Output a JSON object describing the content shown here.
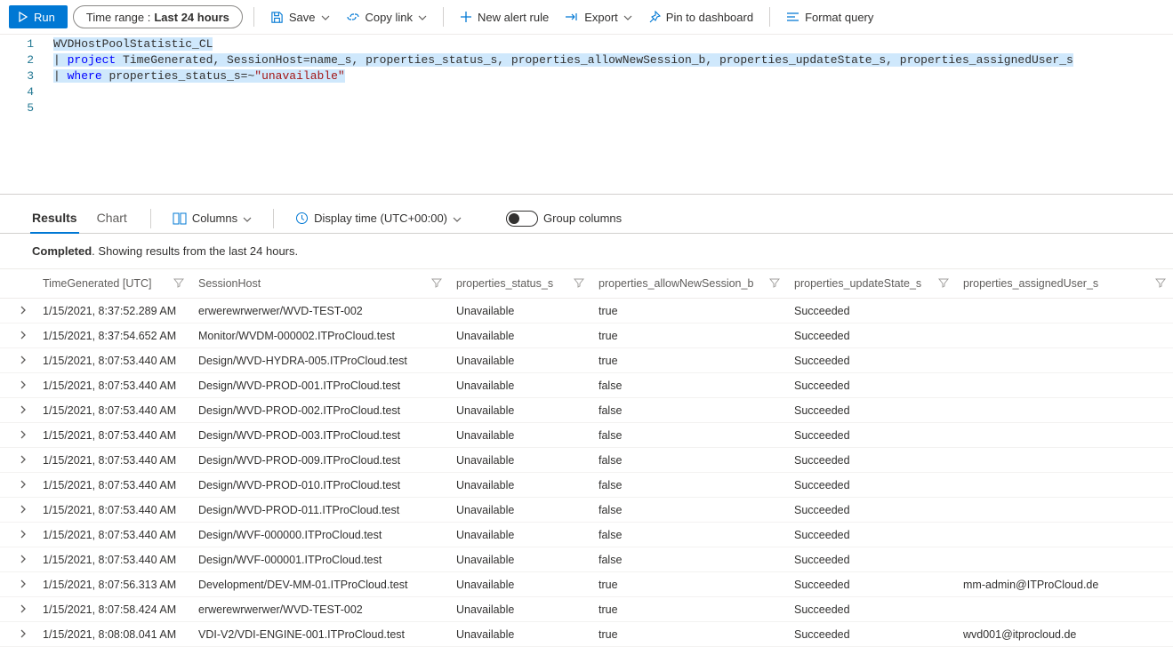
{
  "toolbar": {
    "run": "Run",
    "time_range_label": "Time range :",
    "time_range_value": "Last 24 hours",
    "save": "Save",
    "copy_link": "Copy link",
    "new_alert": "New alert rule",
    "export": "Export",
    "pin": "Pin to dashboard",
    "format": "Format query"
  },
  "query": {
    "lines": [
      "WVDHostPoolStatistic_CL",
      "| project TimeGenerated, SessionHost=name_s, properties_status_s, properties_allowNewSession_b, properties_updateState_s, properties_assignedUser_s",
      "| where properties_status_s=~\"unavailable\"",
      "",
      ""
    ],
    "keywords_project": "project",
    "keywords_where": "where",
    "string_unavailable": "\"unavailable\""
  },
  "results_header": {
    "tab_results": "Results",
    "tab_chart": "Chart",
    "columns": "Columns",
    "display_time": "Display time (UTC+00:00)",
    "group_columns": "Group columns"
  },
  "status": {
    "prefix": "Completed",
    "suffix": ". Showing results from the last 24 hours."
  },
  "columns": [
    "TimeGenerated [UTC]",
    "SessionHost",
    "properties_status_s",
    "properties_allowNewSession_b",
    "properties_updateState_s",
    "properties_assignedUser_s"
  ],
  "rows": [
    {
      "time": "1/15/2021, 8:37:52.289 AM",
      "host": "erwerewrwerwer/WVD-TEST-002",
      "status": "Unavailable",
      "allow": "true",
      "update": "Succeeded",
      "user": ""
    },
    {
      "time": "1/15/2021, 8:37:54.652 AM",
      "host": "Monitor/WVDM-000002.ITProCloud.test",
      "status": "Unavailable",
      "allow": "true",
      "update": "Succeeded",
      "user": ""
    },
    {
      "time": "1/15/2021, 8:07:53.440 AM",
      "host": "Design/WVD-HYDRA-005.ITProCloud.test",
      "status": "Unavailable",
      "allow": "true",
      "update": "Succeeded",
      "user": ""
    },
    {
      "time": "1/15/2021, 8:07:53.440 AM",
      "host": "Design/WVD-PROD-001.ITProCloud.test",
      "status": "Unavailable",
      "allow": "false",
      "update": "Succeeded",
      "user": ""
    },
    {
      "time": "1/15/2021, 8:07:53.440 AM",
      "host": "Design/WVD-PROD-002.ITProCloud.test",
      "status": "Unavailable",
      "allow": "false",
      "update": "Succeeded",
      "user": ""
    },
    {
      "time": "1/15/2021, 8:07:53.440 AM",
      "host": "Design/WVD-PROD-003.ITProCloud.test",
      "status": "Unavailable",
      "allow": "false",
      "update": "Succeeded",
      "user": ""
    },
    {
      "time": "1/15/2021, 8:07:53.440 AM",
      "host": "Design/WVD-PROD-009.ITProCloud.test",
      "status": "Unavailable",
      "allow": "false",
      "update": "Succeeded",
      "user": ""
    },
    {
      "time": "1/15/2021, 8:07:53.440 AM",
      "host": "Design/WVD-PROD-010.ITProCloud.test",
      "status": "Unavailable",
      "allow": "false",
      "update": "Succeeded",
      "user": ""
    },
    {
      "time": "1/15/2021, 8:07:53.440 AM",
      "host": "Design/WVD-PROD-011.ITProCloud.test",
      "status": "Unavailable",
      "allow": "false",
      "update": "Succeeded",
      "user": ""
    },
    {
      "time": "1/15/2021, 8:07:53.440 AM",
      "host": "Design/WVF-000000.ITProCloud.test",
      "status": "Unavailable",
      "allow": "false",
      "update": "Succeeded",
      "user": ""
    },
    {
      "time": "1/15/2021, 8:07:53.440 AM",
      "host": "Design/WVF-000001.ITProCloud.test",
      "status": "Unavailable",
      "allow": "false",
      "update": "Succeeded",
      "user": ""
    },
    {
      "time": "1/15/2021, 8:07:56.313 AM",
      "host": "Development/DEV-MM-01.ITProCloud.test",
      "status": "Unavailable",
      "allow": "true",
      "update": "Succeeded",
      "user": "mm-admin@ITProCloud.de"
    },
    {
      "time": "1/15/2021, 8:07:58.424 AM",
      "host": "erwerewrwerwer/WVD-TEST-002",
      "status": "Unavailable",
      "allow": "true",
      "update": "Succeeded",
      "user": ""
    },
    {
      "time": "1/15/2021, 8:08:08.041 AM",
      "host": "VDI-V2/VDI-ENGINE-001.ITProCloud.test",
      "status": "Unavailable",
      "allow": "true",
      "update": "Succeeded",
      "user": "wvd001@itprocloud.de"
    }
  ]
}
